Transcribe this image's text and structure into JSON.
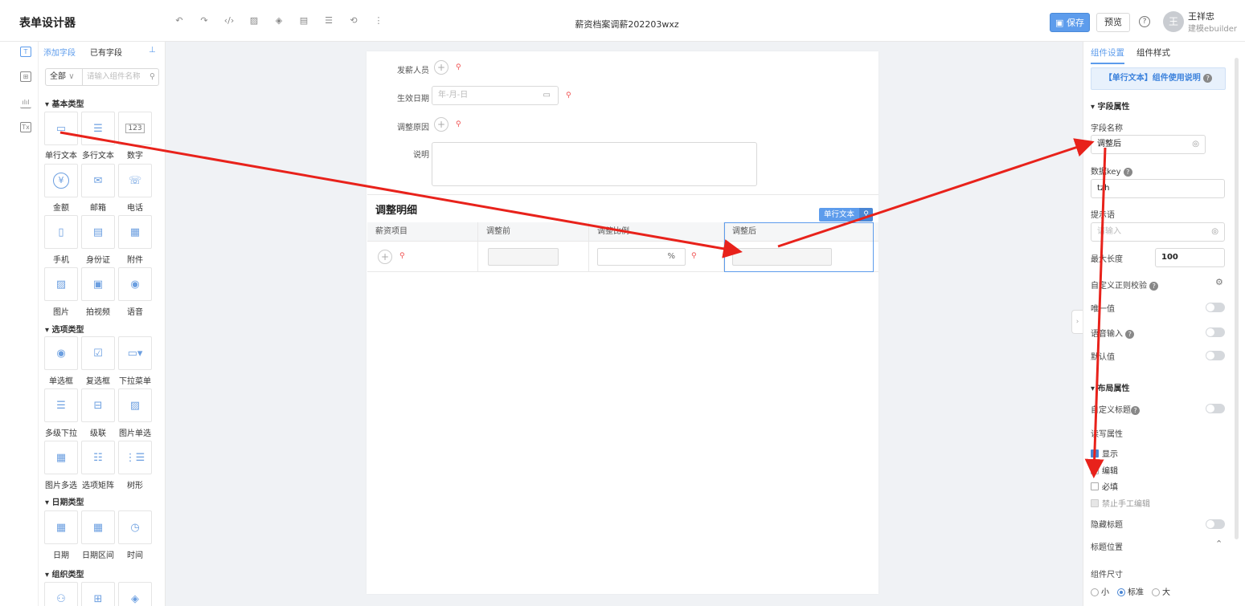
{
  "header": {
    "app_title": "表单设计器",
    "doc_title": "薪资档案调薪202203wxz",
    "save_label": "保存",
    "preview_label": "预览",
    "user_name": "王祥忠",
    "user_org": "建模ebuilder",
    "avatar_letter": "王",
    "tool_icons": [
      "undo-icon",
      "redo-icon",
      "code-icon",
      "image-icon",
      "layers-icon",
      "database-icon",
      "list-icon",
      "history-icon",
      "more-icon"
    ]
  },
  "library": {
    "tab_add": "添加字段",
    "tab_existing": "已有字段",
    "pin": "⊥",
    "category": "全部",
    "search_placeholder": "请输入组件名称",
    "sections": {
      "basic": "基本类型",
      "option": "选项类型",
      "date": "日期类型",
      "org": "组织类型"
    },
    "basic": [
      "单行文本",
      "多行文本",
      "数字",
      "金额",
      "邮箱",
      "电话",
      "手机",
      "身份证",
      "附件",
      "图片",
      "拍视频",
      "语音"
    ],
    "option": [
      "单选框",
      "复选框",
      "下拉菜单",
      "多级下拉",
      "级联",
      "图片单选",
      "图片多选",
      "选项矩阵",
      "树形"
    ],
    "date": [
      "日期",
      "日期区间",
      "时间"
    ],
    "number_glyph": "123",
    "amount_glyph": "¥"
  },
  "form": {
    "fields": {
      "issuer": "发薪人员",
      "effective_date": "生效日期",
      "reason": "调整原因",
      "note": "说明"
    },
    "date_placeholder": "年-月-日",
    "detail": {
      "title": "调整明细",
      "badge": "单行文本",
      "columns": [
        "薪资项目",
        "调整前",
        "调整比例",
        "调整后"
      ],
      "percent": "%"
    }
  },
  "panel": {
    "tab_settings": "组件设置",
    "tab_style": "组件样式",
    "help": "【单行文本】组件使用说明",
    "field_section": "字段属性",
    "field_name_label": "字段名称",
    "field_name_value": "调整后",
    "data_key_label": "数据key",
    "data_key_value": "tzh",
    "hint_label": "提示语",
    "hint_placeholder": "请输入",
    "max_length_label": "最大长度",
    "max_length_value": "100",
    "regex_label": "自定义正则校验",
    "unique_label": "唯一值",
    "voice_label": "语音输入",
    "default_label": "默认值",
    "layout_section": "布局属性",
    "custom_title_label": "自定义标题",
    "rw_label": "读写属性",
    "show_label": "显示",
    "edit_label": "编辑",
    "required_label": "必填",
    "no_manual_label": "禁止手工编辑",
    "hide_title_label": "隐藏标题",
    "title_pos_label": "标题位置",
    "size_label": "组件尺寸",
    "size_options": [
      "小",
      "标准",
      "大"
    ],
    "size_selected": "标准"
  },
  "colors": {
    "accent": "#5d9cec",
    "arrow": "#e8221b",
    "required": "#f05050"
  }
}
